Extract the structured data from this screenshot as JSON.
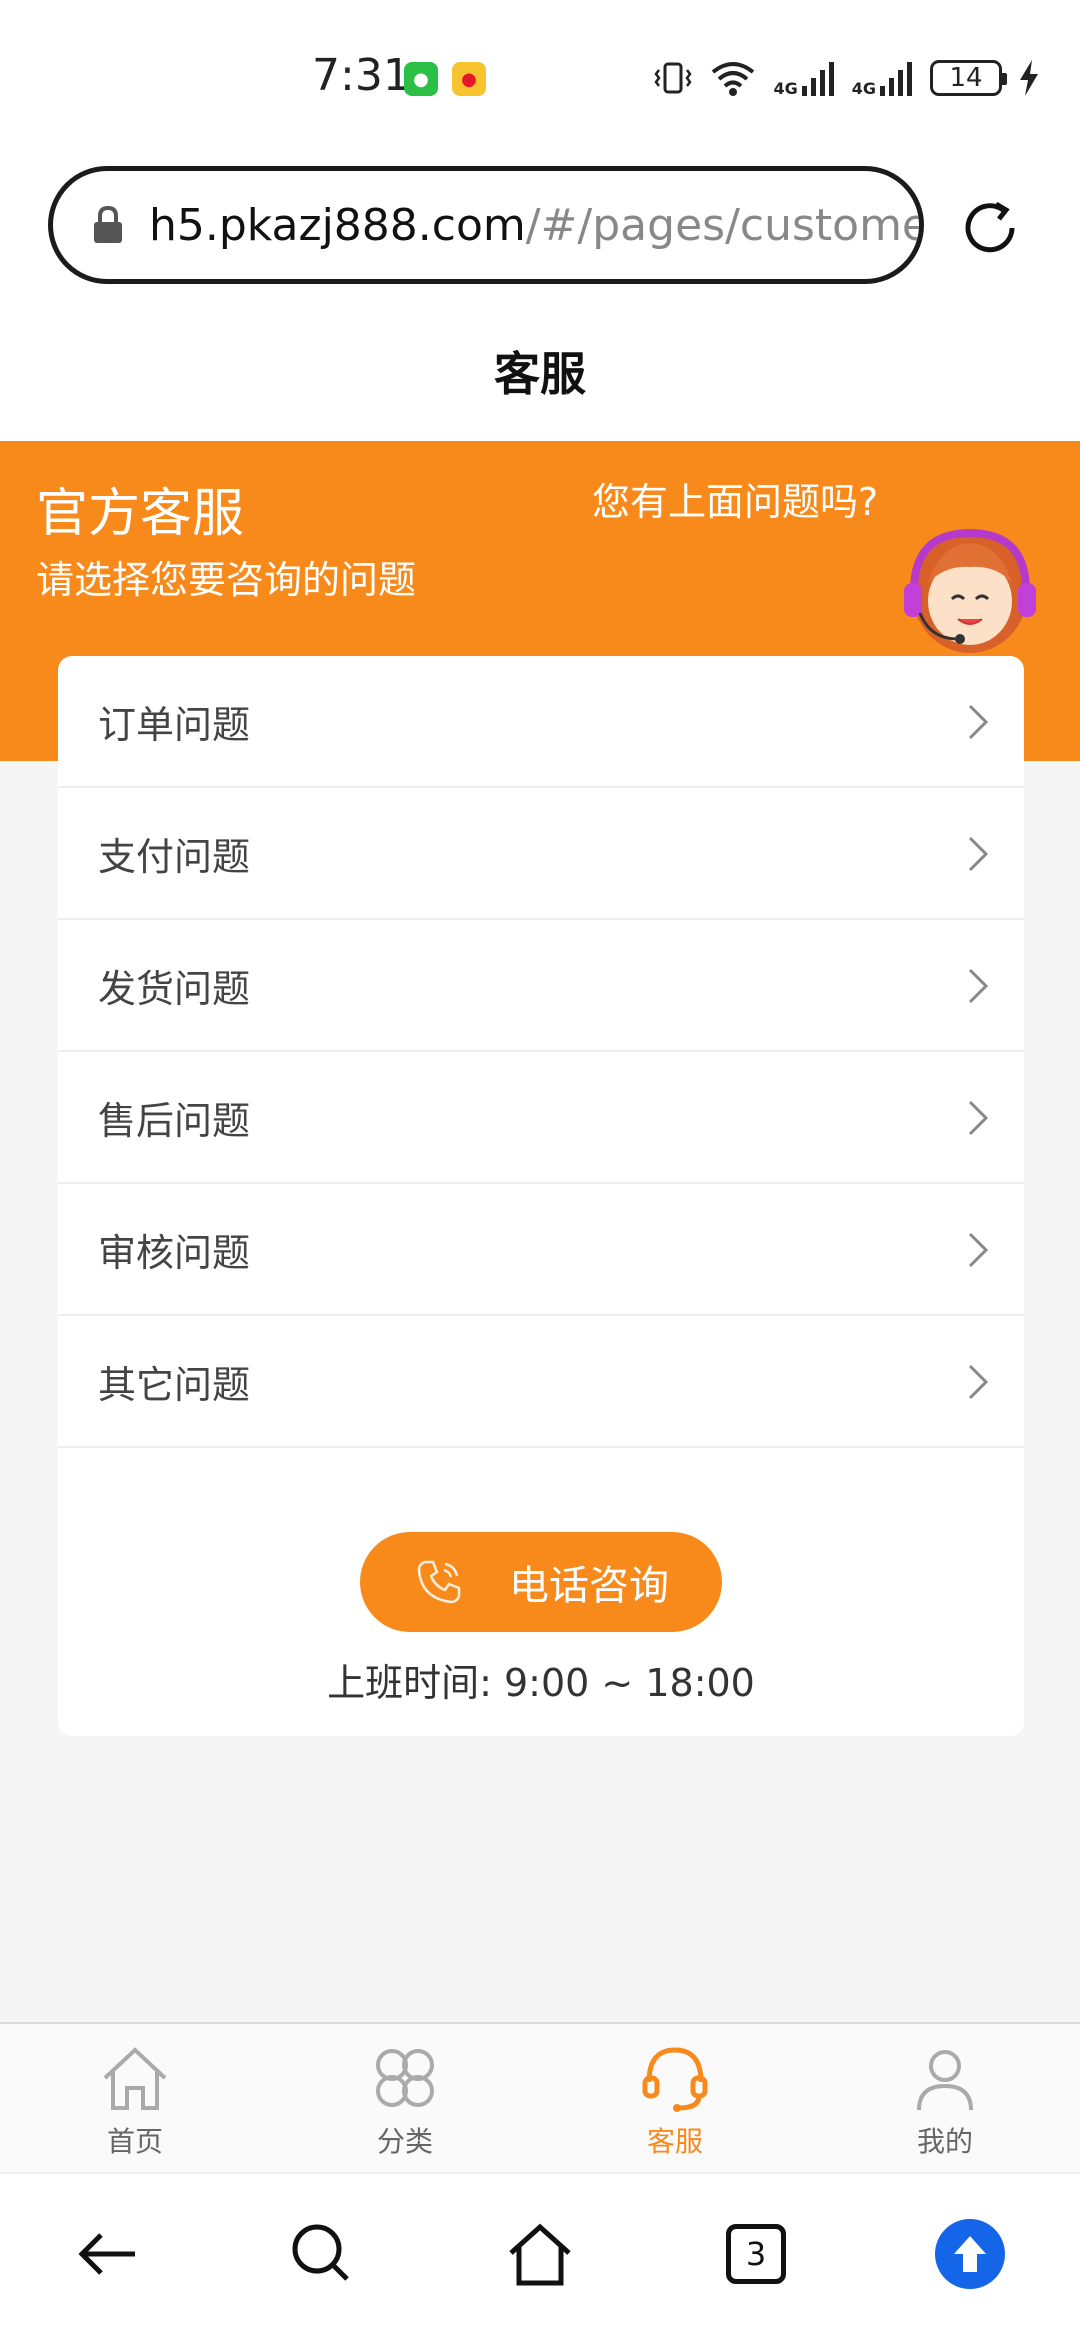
{
  "status": {
    "time": "7:31",
    "battery": "14",
    "network1": "4G",
    "network2": "4G"
  },
  "browser": {
    "url_host": "h5.pkazj888.com",
    "url_path": "/#/pages/custome"
  },
  "header": {
    "title": "客服"
  },
  "banner": {
    "title": "官方客服",
    "subtitle": "请选择您要咨询的问题",
    "question": "您有上面问题吗?"
  },
  "menu": {
    "items": [
      {
        "label": "订单问题"
      },
      {
        "label": "支付问题"
      },
      {
        "label": "发货问题"
      },
      {
        "label": "售后问题"
      },
      {
        "label": "审核问题"
      },
      {
        "label": "其它问题"
      }
    ]
  },
  "contact": {
    "phone_label": "电话咨询",
    "hours": "上班时间:  9:00 ~ 18:00"
  },
  "tabs": [
    {
      "label": "首页",
      "icon": "home-icon"
    },
    {
      "label": "分类",
      "icon": "category-icon"
    },
    {
      "label": "客服",
      "icon": "headset-icon",
      "active": true
    },
    {
      "label": "我的",
      "icon": "user-icon"
    }
  ],
  "browser_nav": {
    "tab_count": "3"
  },
  "colors": {
    "accent": "#f88a1b",
    "background": "#f5f5f5",
    "upload_blue": "#1565e8"
  }
}
